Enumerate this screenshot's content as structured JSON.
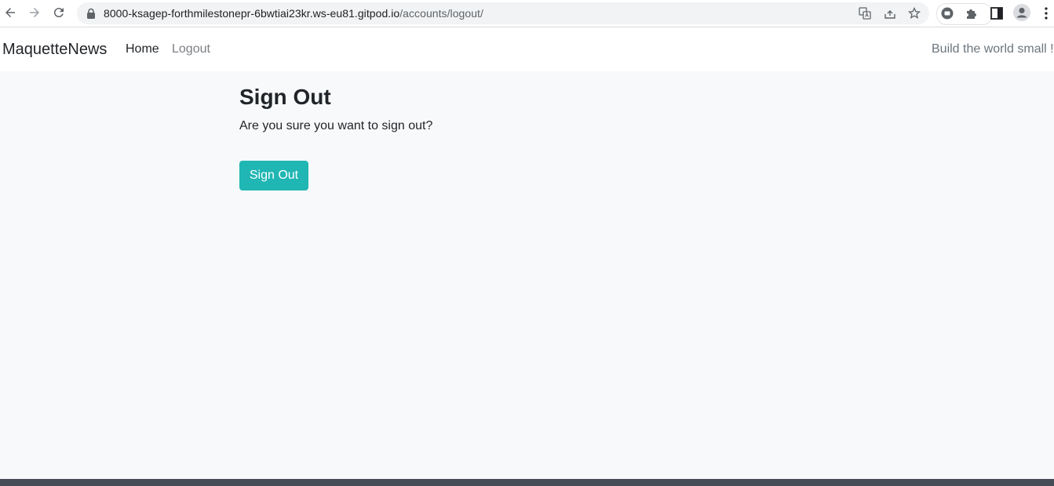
{
  "browser": {
    "url_host": "8000-ksagep-forthmilestonepr-6bwtiai23kr.ws-eu81.gitpod.io",
    "url_path": "/accounts/logout/",
    "icons": [
      "back-icon",
      "forward-icon",
      "reload-icon",
      "lock-icon",
      "translate-icon",
      "share-icon",
      "bookmark-star-icon",
      "extension-circle-icon",
      "puzzle-icon",
      "side-panel-icon",
      "profile-icon",
      "kebab-menu-icon"
    ]
  },
  "navbar": {
    "brand": "MaquetteNews",
    "links": [
      {
        "label": "Home"
      },
      {
        "label": "Logout"
      }
    ],
    "tagline": "Build the world small !"
  },
  "main": {
    "title": "Sign Out",
    "question": "Are you sure you want to sign out?",
    "button_label": "Sign Out"
  },
  "colors": {
    "page_background": "#f8f9fa",
    "button_accent": "#20b6b3",
    "footer": "#454c55"
  }
}
